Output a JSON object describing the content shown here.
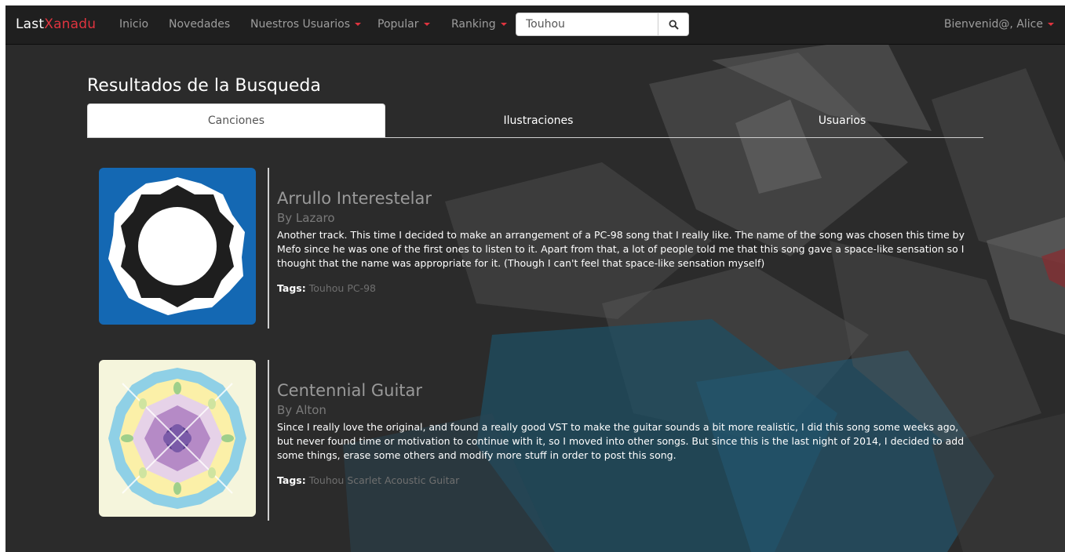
{
  "navbar": {
    "brand_part1": "Last",
    "brand_part2": "Xanadu",
    "items": [
      {
        "label": "Inicio"
      },
      {
        "label": "Novedades"
      },
      {
        "label": "Nuestros Usuarios"
      },
      {
        "label": "Popular"
      },
      {
        "label": "Ranking"
      }
    ],
    "search_value": "Touhou",
    "welcome": "Bienvenid@, Alice"
  },
  "page": {
    "title": "Resultados de la Busqueda"
  },
  "tabs": [
    {
      "label": "Canciones",
      "active": true
    },
    {
      "label": "Ilustraciones",
      "active": false
    },
    {
      "label": "Usuarios",
      "active": false
    }
  ],
  "songs": [
    {
      "title": "Arrullo Interestelar",
      "author": "By Lazaro",
      "description": "Another track. This time I decided to make an arrangement of a PC-98 song that I really like. The name of the song was chosen this time by Mefo since he was one of the first ones to listen to it. Apart from that, a lot of people told me that this song gave a space-like sensation so I thought that the name was appropriate for it. (Though I can't feel that space-like sensation myself)",
      "tags_label": "Tags:",
      "tags": [
        "Touhou",
        "PC-98"
      ]
    },
    {
      "title": "Centennial Guitar",
      "author": "By Alton",
      "description": "Since I really love the original, and found a really good VST to make the guitar sounds a bit more realistic, I did this song some weeks ago, but never found time or motivation to continue with it, so I moved into other songs. But since this is the last night of 2014, I decided to add some things, erase some others and modify more stuff in order to post this song.",
      "tags_label": "Tags:",
      "tags": [
        "Touhou",
        "Scarlet",
        "Acoustic",
        "Guitar"
      ]
    }
  ],
  "colors": {
    "accent": "#e0343f",
    "navbar_bg": "#1f1f1f",
    "page_bg": "#2b2b2b"
  }
}
